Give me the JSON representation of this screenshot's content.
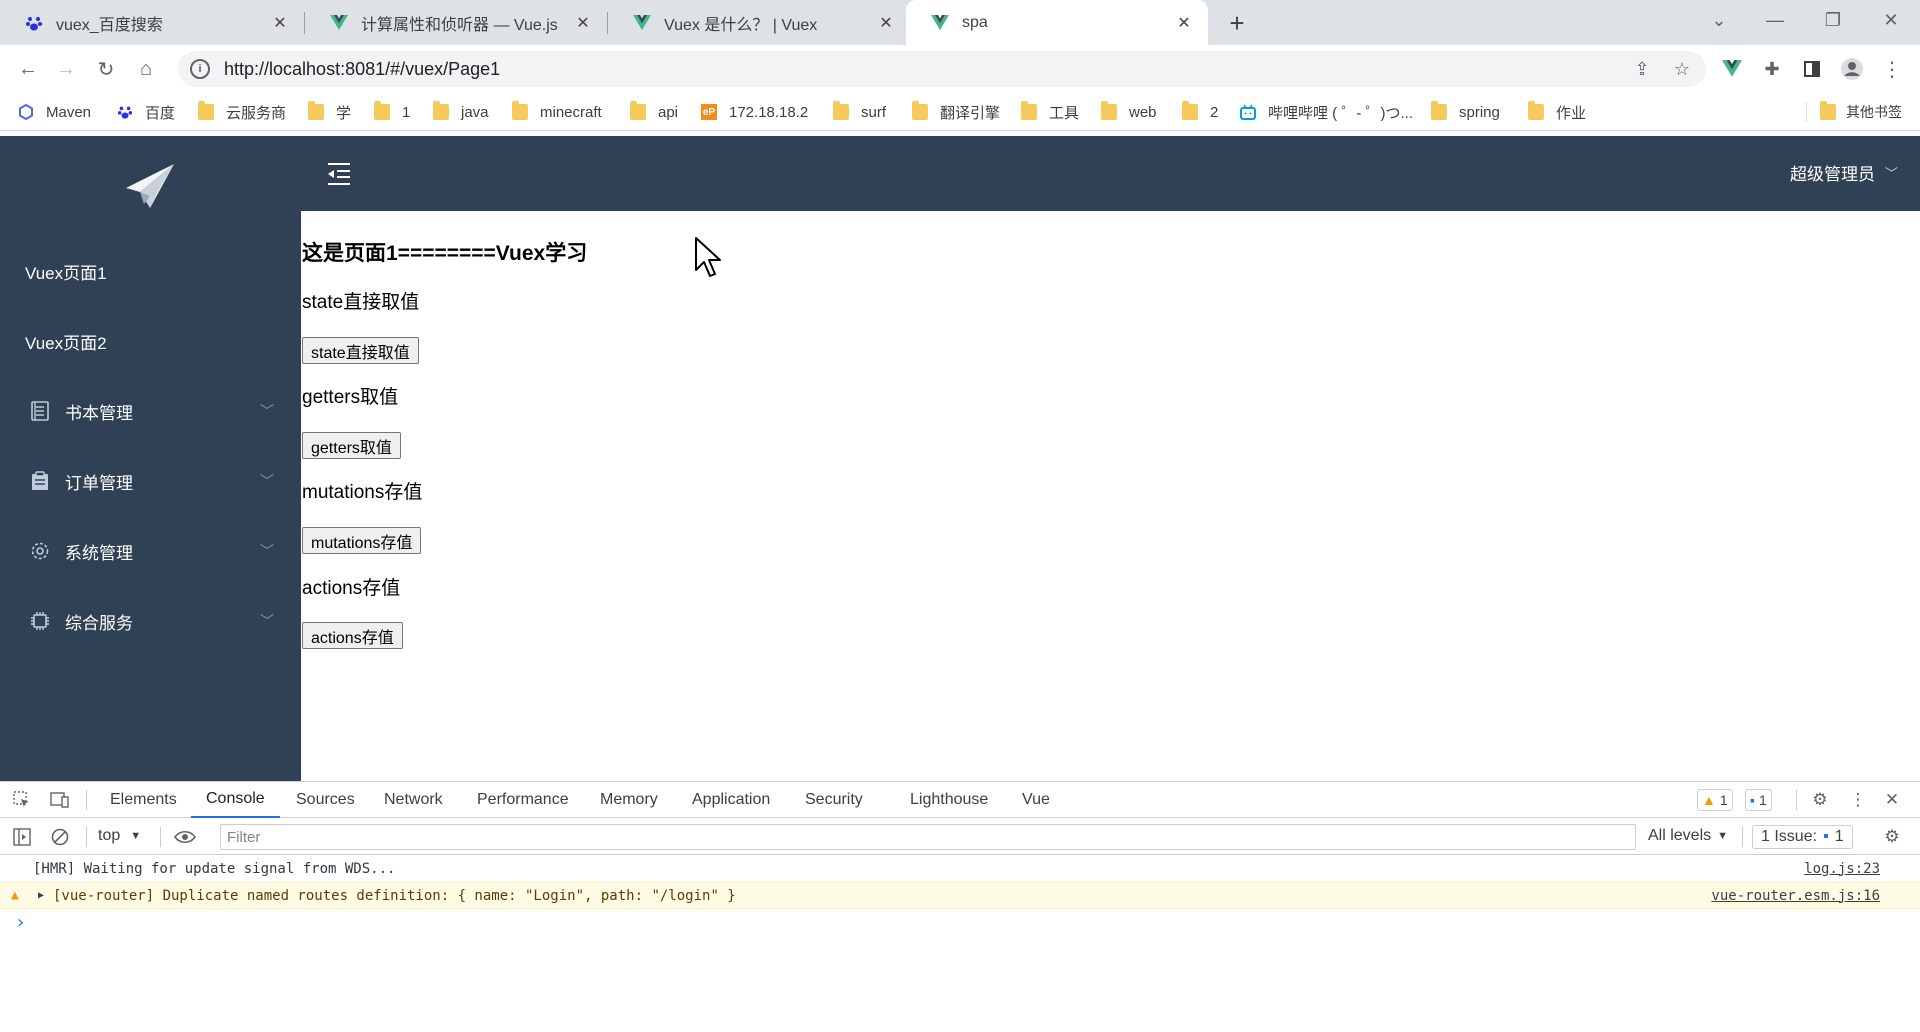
{
  "browser": {
    "tabs": [
      {
        "title": "vuex_百度搜索",
        "icon": "baidu-paw-icon"
      },
      {
        "title": "计算属性和侦听器 — Vue.js",
        "icon": "vue-logo-icon"
      },
      {
        "title": "Vuex 是什么？ | Vuex",
        "icon": "vue-logo-icon"
      },
      {
        "title": "spa",
        "icon": "vue-logo-icon"
      }
    ],
    "url": "http://localhost:8081/#/vuex/Page1",
    "bookmarks": [
      {
        "label": "Maven",
        "icon": "maven-icon"
      },
      {
        "label": "百度",
        "icon": "baidu-paw-icon"
      },
      {
        "label": "云服务商",
        "icon": "folder-icon"
      },
      {
        "label": "学",
        "icon": "folder-icon"
      },
      {
        "label": "1",
        "icon": "folder-icon"
      },
      {
        "label": "java",
        "icon": "folder-icon"
      },
      {
        "label": "minecraft",
        "icon": "folder-icon"
      },
      {
        "label": "api",
        "icon": "folder-icon"
      },
      {
        "label": "172.18.18.2",
        "icon": "ep-icon"
      },
      {
        "label": "surf",
        "icon": "folder-icon"
      },
      {
        "label": "翻译引擎",
        "icon": "folder-icon"
      },
      {
        "label": "工具",
        "icon": "folder-icon"
      },
      {
        "label": "web",
        "icon": "folder-icon"
      },
      {
        "label": "2",
        "icon": "folder-icon"
      },
      {
        "label": "哔哩哔哩 ( ゜- ゜)つ...",
        "icon": "bilibili-icon"
      },
      {
        "label": "spring",
        "icon": "folder-icon"
      },
      {
        "label": "作业",
        "icon": "folder-icon"
      }
    ],
    "other_bookmarks": "其他书签"
  },
  "app": {
    "sidebar": {
      "items": [
        {
          "label": "Vuex页面1"
        },
        {
          "label": "Vuex页面2"
        },
        {
          "label": "书本管理",
          "icon": "document-icon"
        },
        {
          "label": "订单管理",
          "icon": "clipboard-icon"
        },
        {
          "label": "系统管理",
          "icon": "gear-icon"
        },
        {
          "label": "综合服务",
          "icon": "chip-icon"
        }
      ]
    },
    "header": {
      "user": "超级管理员"
    },
    "page": {
      "heading": "这是页面1========Vuex学习",
      "sections": [
        {
          "label": "state直接取值",
          "button": "state直接取值"
        },
        {
          "label": "getters取值",
          "button": "getters取值"
        },
        {
          "label": "mutations存值",
          "button": "mutations存值"
        },
        {
          "label": "actions存值",
          "button": "actions存值"
        }
      ]
    }
  },
  "devtools": {
    "tabs": [
      "Elements",
      "Console",
      "Sources",
      "Network",
      "Performance",
      "Memory",
      "Application",
      "Security",
      "Lighthouse",
      "Vue"
    ],
    "active_tab": "Console",
    "warnings_count": "1",
    "messages_count": "1",
    "context": "top",
    "filter_placeholder": "Filter",
    "levels": "All levels",
    "issues_label": "1 Issue:",
    "issues_count": "1",
    "console": [
      {
        "text": "[HMR] Waiting for update signal from WDS...",
        "source": "log.js:23",
        "level": "info"
      },
      {
        "text": "[vue-router] Duplicate named routes definition: { name: \"Login\", path: \"/login\" }",
        "source": "vue-router.esm.js:16",
        "level": "warning"
      }
    ],
    "prompt": "›"
  },
  "colors": {
    "sidebar": "#304156",
    "accent": "#1a73e8",
    "vue_green": "#42b883"
  }
}
